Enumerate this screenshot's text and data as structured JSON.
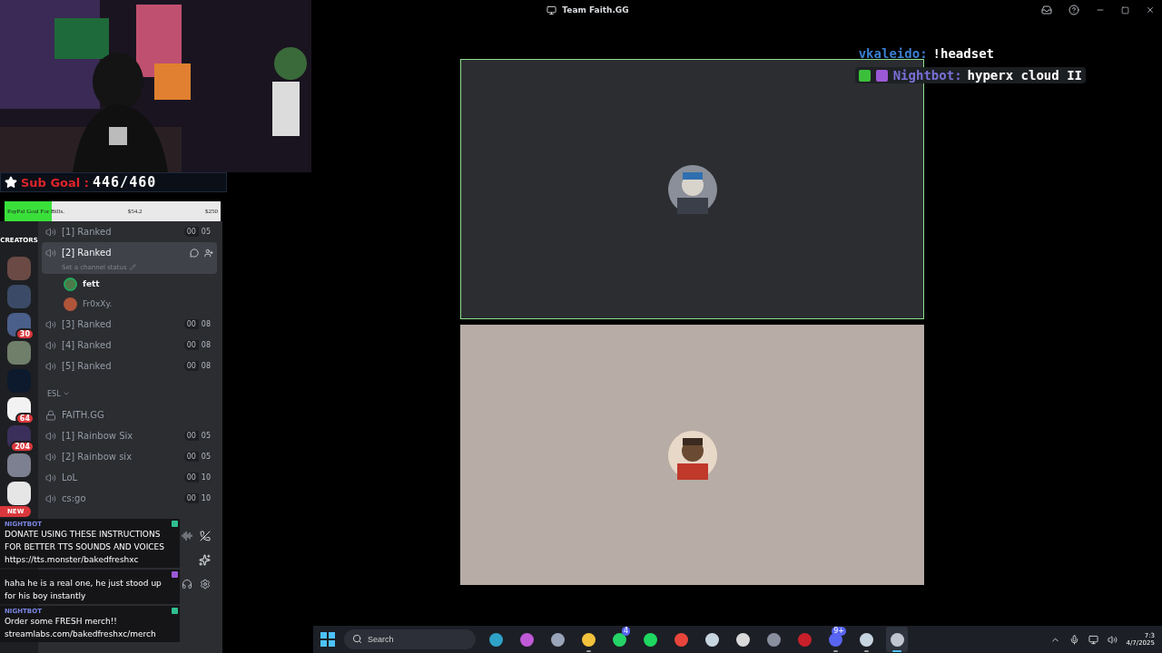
{
  "window": {
    "title": "Team Faith.GG"
  },
  "sub_goal": {
    "label": "Sub Goal",
    "separator": ":",
    "count": "446/460"
  },
  "paypal_goal": {
    "label": "PayPal Goal For Bills.",
    "amount": "$54.2",
    "target": "$250",
    "level": 0.22
  },
  "servers": [
    {
      "kind": "logo",
      "label": "CREATORS",
      "color": "#1e1f22"
    },
    {
      "kind": "icon",
      "color": "#6b4a45"
    },
    {
      "kind": "icon",
      "color": "#3b4a66"
    },
    {
      "kind": "icon",
      "color": "#4a5f8a",
      "badge": "30"
    },
    {
      "kind": "icon",
      "color": "#6f7f6a"
    },
    {
      "kind": "icon",
      "color": "#0d1a2e"
    },
    {
      "kind": "icon",
      "color": "#f2f2f2",
      "badge": "64"
    },
    {
      "kind": "icon",
      "color": "#3a2f5a",
      "badge": "204"
    },
    {
      "kind": "icon",
      "color": "#7c8090"
    },
    {
      "kind": "icon",
      "color": "#e6e6e6"
    }
  ],
  "new_pill": "NEW",
  "sections": [
    {
      "channels": [
        {
          "kind": "voice",
          "name": "[1] Ranked",
          "users": "00",
          "limit": "05",
          "selected": false
        },
        {
          "kind": "voice",
          "name": "[2] Ranked",
          "selected": true,
          "status": "Set a channel status",
          "members": [
            {
              "name": "fett",
              "speaking": true,
              "color": "#4e7a4a"
            },
            {
              "name": "Fr0xXy.",
              "speaking": false,
              "color": "#b0553a"
            }
          ]
        },
        {
          "kind": "voice",
          "name": "[3] Ranked",
          "users": "00",
          "limit": "08",
          "selected": false
        },
        {
          "kind": "voice",
          "name": "[4] Ranked",
          "users": "00",
          "limit": "08",
          "selected": false
        },
        {
          "kind": "voice",
          "name": "[5] Ranked",
          "users": "00",
          "limit": "08",
          "selected": false
        }
      ]
    },
    {
      "category": "ESL",
      "channels": [
        {
          "kind": "locked",
          "name": "FAITH.GG",
          "selected": false
        },
        {
          "kind": "voice",
          "name": "[1] Rainbow Six",
          "users": "00",
          "limit": "05",
          "selected": false
        },
        {
          "kind": "voice",
          "name": "[2] Rainbow six",
          "users": "00",
          "limit": "05",
          "selected": false
        },
        {
          "kind": "voice",
          "name": "LoL",
          "users": "00",
          "limit": "10",
          "selected": false
        },
        {
          "kind": "voice",
          "name": "cs:go",
          "users": "00",
          "limit": "10",
          "selected": false
        }
      ]
    }
  ],
  "stream_chat": [
    {
      "kind": "bot",
      "user": "NIGHTBOT",
      "text": "DONATE USING THESE INSTRUCTIONS FOR BETTER TTS SOUNDS AND VOICES https://tts.monster/bakedfreshxc"
    },
    {
      "kind": "subscriber",
      "text": "haha he is a real one, he just stood up for his boy instantly"
    },
    {
      "kind": "bot",
      "user": "NIGHTBOT",
      "text": "Order some FRESH merch!! streamlabs.com/bakedfreshxc/merch"
    }
  ],
  "overlay_chat": [
    {
      "user": "vkaleido",
      "separator": ":",
      "text": "!headset",
      "color": "#3b7fd0"
    },
    {
      "user": "Nightbot",
      "separator": ":",
      "text": "hyperx cloud II",
      "color": "#7a6fd6",
      "badges": [
        {
          "kind": "moderator"
        },
        {
          "kind": "verified"
        }
      ]
    }
  ],
  "video_tiles": [
    {
      "speaking": true,
      "color": "#2b2d31"
    },
    {
      "speaking": false,
      "color": "#b8aca6"
    }
  ],
  "taskbar": {
    "search": {
      "placeholder": "Search"
    },
    "apps": [
      {
        "color": "#2fa3c7",
        "running": false
      },
      {
        "color": "#c05ad8",
        "running": false
      },
      {
        "color": "#9aa4b8",
        "running": false
      },
      {
        "color": "#f3c23c",
        "running": true
      },
      {
        "color": "#25d366",
        "running": false,
        "badge": "4"
      },
      {
        "color": "#1ed760",
        "running": false
      },
      {
        "color": "#e8453c",
        "running": false
      },
      {
        "color": "#c7d5e0",
        "running": false
      },
      {
        "color": "#d9d9d9",
        "running": false
      },
      {
        "color": "#8a8fa0",
        "running": false
      },
      {
        "color": "#c8202a",
        "running": false
      },
      {
        "color": "#5865f2",
        "running": true,
        "badge": "9+"
      },
      {
        "color": "#c7d5e0",
        "running": true
      },
      {
        "color": "#bfc6d0",
        "running": true,
        "selected": true
      }
    ],
    "clock": {
      "time": "7:3",
      "date": "4/7/2025"
    }
  }
}
